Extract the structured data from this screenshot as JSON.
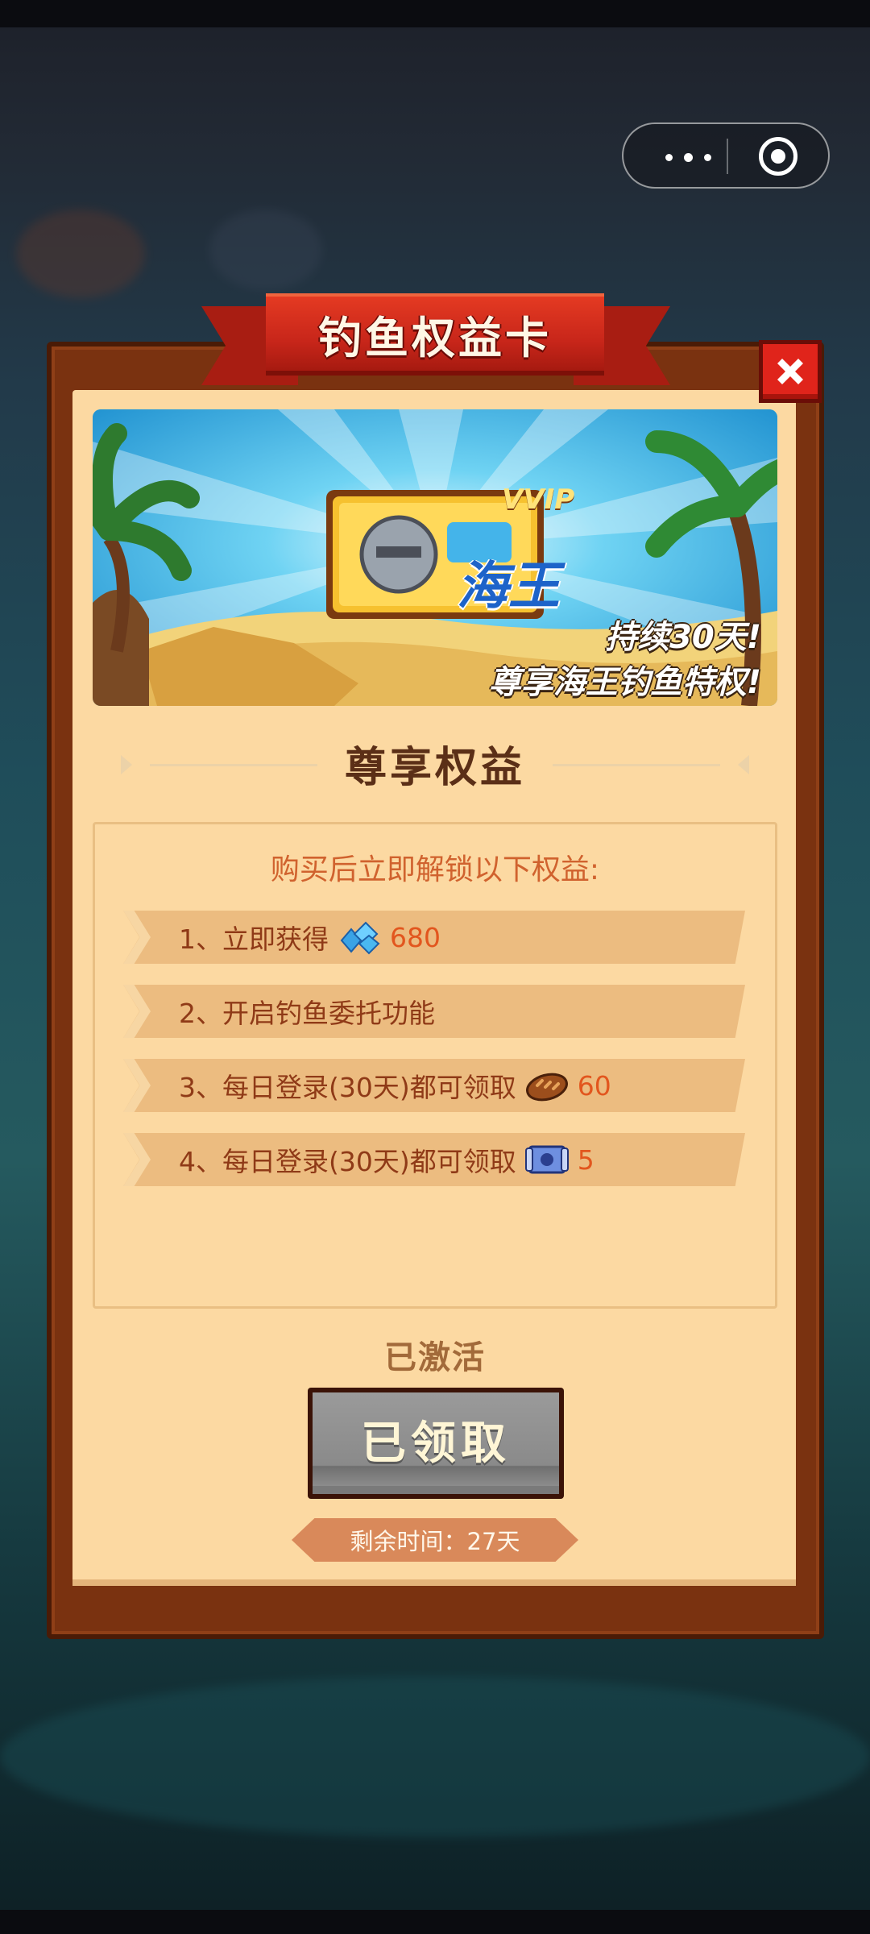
{
  "capsule": {
    "more_icon": "more-dots-icon",
    "close_icon": "target-circle-icon"
  },
  "modal": {
    "title": "钓鱼权益卡",
    "close_icon": "close-x-icon",
    "banner": {
      "badge_text": "VVIP",
      "badge_name": "海王",
      "caption_line1": "持续30天!",
      "caption_line2": "尊享海王钓鱼特权!"
    },
    "section_title": "尊享权益",
    "intro": "购买后立即解锁以下权益:",
    "benefits": [
      {
        "text": "1、立即获得",
        "icon": "diamond-gems-icon",
        "value": "680"
      },
      {
        "text": "2、开启钓鱼委托功能",
        "icon": "",
        "value": ""
      },
      {
        "text": "3、每日登录(30天)都可领取",
        "icon": "bread-icon",
        "value": "60"
      },
      {
        "text": "4、每日登录(30天)都可领取",
        "icon": "ticket-scroll-icon",
        "value": "5"
      }
    ],
    "status": "已激活",
    "claim_button": "已领取",
    "remaining": "剩余时间：27天"
  },
  "colors": {
    "frame": "#7a3210",
    "panel": "#fcd9a2",
    "ribbon": "#c8261a",
    "row": "#ecbc80",
    "accent_text": "#e2561e"
  }
}
